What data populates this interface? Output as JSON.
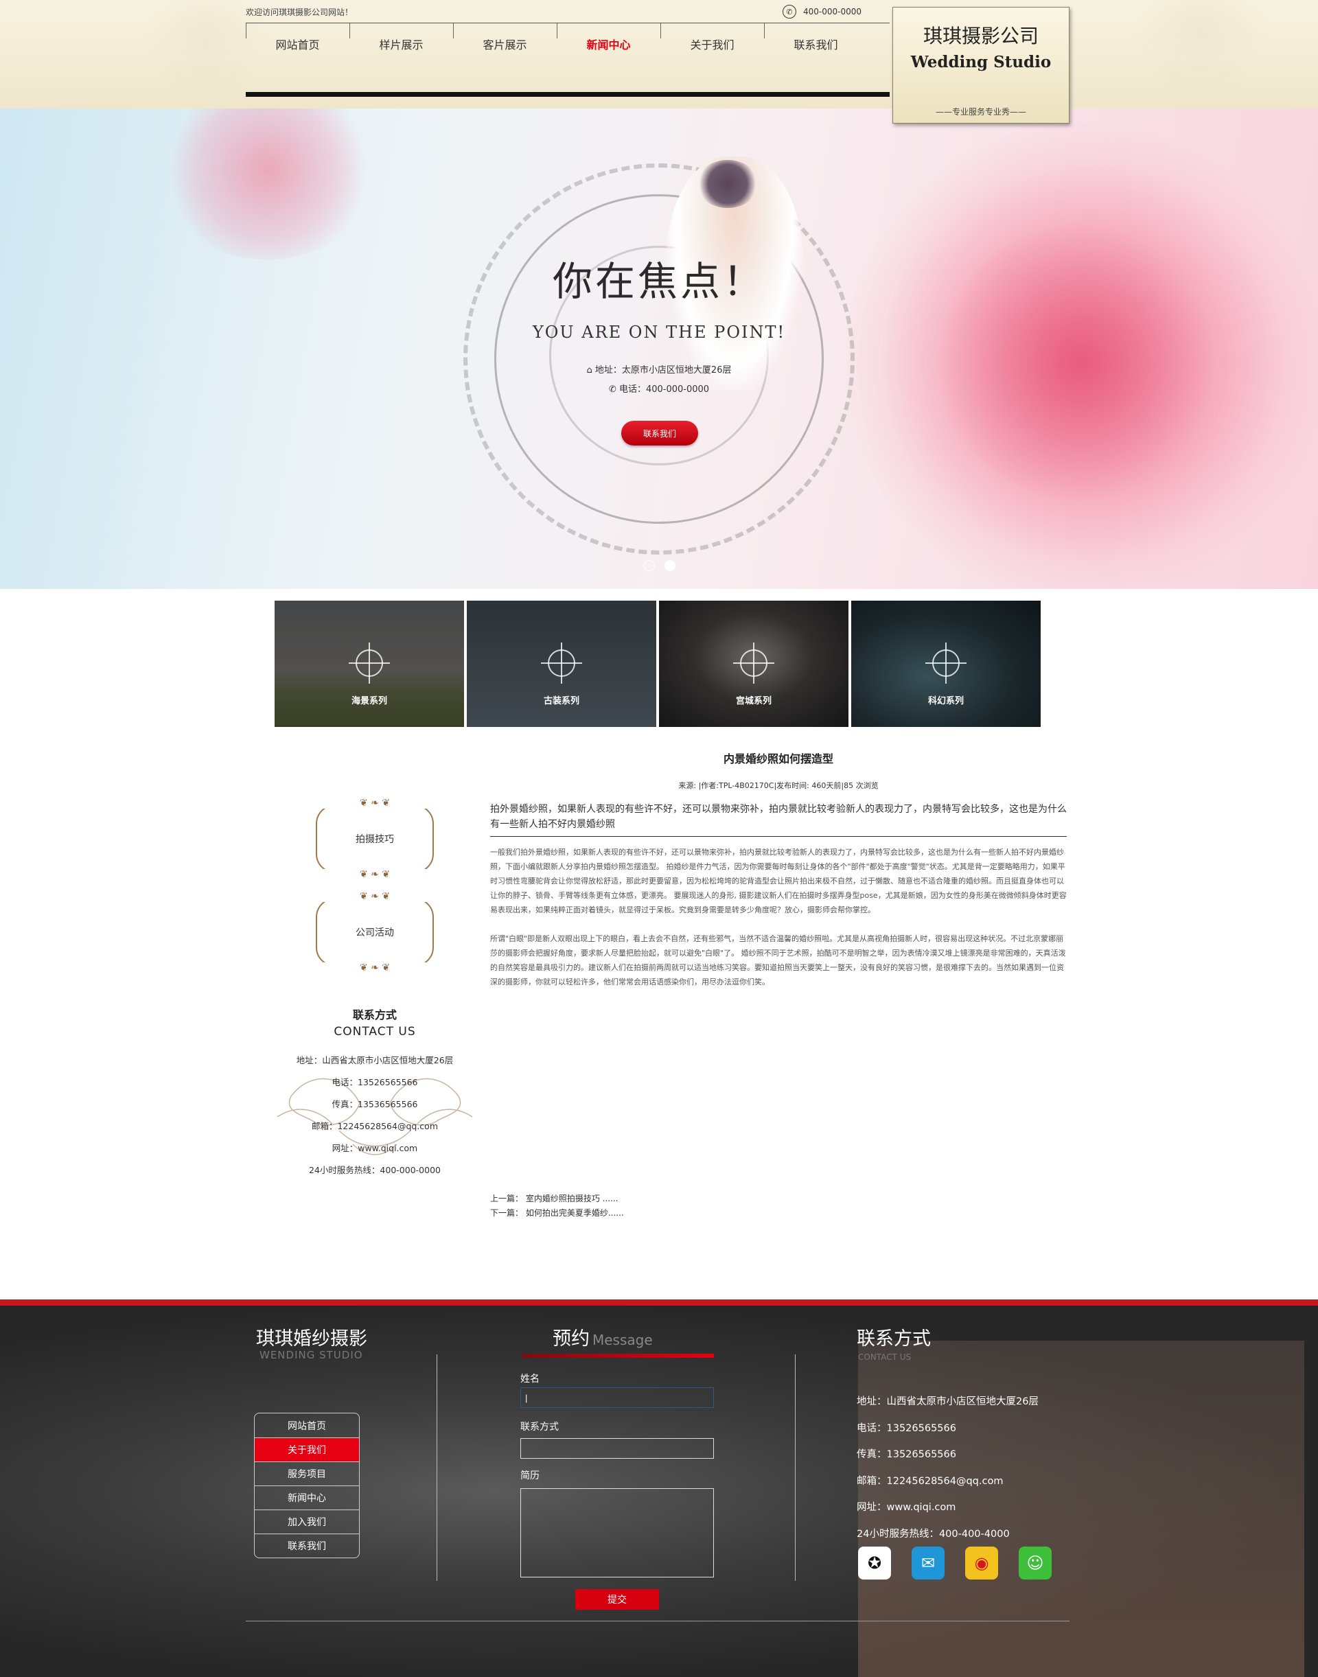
{
  "header": {
    "welcome": "欢迎访问琪琪摄影公司网站！",
    "phone": "400-000-0000",
    "nav": [
      "网站首页",
      "样片展示",
      "客片展示",
      "新闻中心",
      "关于我们",
      "联系我们"
    ],
    "nav_active_index": 3,
    "logo": {
      "cn": "琪琪摄影公司",
      "en": "Wedding Studio",
      "slogan": "——专业服务专业秀——"
    }
  },
  "banner": {
    "title_cn": "你在焦点！",
    "title_en": "YOU ARE ON THE POINT!",
    "address": "地址：太原市小店区恒地大厦26层",
    "tel": "电话：400-000-0000",
    "button": "联系我们",
    "slides": 2,
    "active_slide": 2
  },
  "gallery": [
    {
      "label": "海景系列"
    },
    {
      "label": "古装系列"
    },
    {
      "label": "宫城系列"
    },
    {
      "label": "科幻系列"
    }
  ],
  "sidebar": {
    "links": [
      "拍摄技巧",
      "公司活动"
    ],
    "contact": {
      "title": "联系方式",
      "subtitle": "CONTACT US",
      "items": [
        "地址：山西省太原市小店区恒地大厦26层",
        "电话：13526565566",
        "传真：13536565566",
        "邮箱：12245628564@qq.com",
        "网址：www.qiqi.com",
        "24小时服务热线：400-000-0000"
      ]
    }
  },
  "article": {
    "title": "内景婚纱照如何摆造型",
    "meta": "来源: |作者:TPL-4B02170C|发布时间: 460天前|85 次浏览",
    "lead": "拍外景婚纱照，如果新人表现的有些许不好，还可以景物来弥补，拍内景就比较考验新人的表现力了，内景特写会比较多，这也是为什么有一些新人拍不好内景婚纱照",
    "paragraphs": [
      "一般我们拍外景婚纱照，如果新人表现的有些许不好，还可以景物来弥补，拍内景就比较考验新人的表现力了，内景特写会比较多，这也是为什么有一些新人拍不好内景婚纱照，下面小编就跟新人分享拍内景婚纱照怎摆造型。 拍婚纱是件力气活，因为你需要每时每刻让身体的各个\"部件\"都处于高度\"警觉\"状态。尤其是背一定要略略用力，如果平时习惯性弯腰驼背会让你觉得放松舒适，那此时更要留意，因为松松垮垮的驼背造型会让照片拍出来极不自然，过于懒散、随意也不适合隆重的婚纱照。而且挺直身体也可以让你的脖子、锁骨、手臂等线条更有立体感，更漂亮。 要展现迷人的身形, 摄影建议新人们在拍摄时多摆弄身型pose，尤其是新娘，因为女性的身形美在微微倾斜身体时更容易表现出来，如果纯粹正面对着镜头，就显得过于呆板。究竟到身需要是转多少角度呢？放心，摄影师会帮你掌控。",
      "所谓\"白眼\"即是新人双眼出现上下的眼白，看上去会不自然，还有些邪气，当然不适合温馨的婚纱照啦。尤其是从高视角拍摄新人时，很容易出现这种状况。不过北京蒙娜丽莎的摄影师会把握好角度，要求新人尽量把脸抬起，就可以避免\"白眼\"了。 婚纱照不同于艺术照，拍酷可不是明智之举，因为表情冷漠又堆上镜漂亮是非常困难的，天真活泼的自然笑容是最具吸引力的。建议新人们在拍摄前两周就可以适当地练习笑容。要知道拍照当天要笑上一整天，没有良好的笑容习惯，是很难撑下去的。当然如果遇到一位资深的摄影师，你就可以轻松许多，他们常常会用话语感染你们，用尽办法逗你们笑。"
    ],
    "prev": "上一篇：   室内婚纱照拍摄技巧 ......",
    "next": "下一篇：   如何拍出完美夏季婚纱......"
  },
  "footer": {
    "brand": "琪琪婚纱摄影",
    "brand_en": "WENDING STUDIO",
    "menu": [
      "网站首页",
      "关于我们",
      "服务项目",
      "新闻中心",
      "加入我们",
      "联系我们"
    ],
    "menu_active_index": 1,
    "message": {
      "title": "预约",
      "title_en": "Message",
      "name_label": "姓名",
      "contact_label": "联系方式",
      "resume_label": "简历",
      "name_value": "|",
      "submit": "提交"
    },
    "contact": {
      "title": "联系方式",
      "subtitle": "CONTACT US",
      "items": [
        "地址：山西省太原市小店区恒地大厦26层",
        "电话：13526565566",
        "传真：13526565566",
        "邮箱：12245628564@qq.com",
        "网址：www.qiqi.com",
        "24小时服务热线：400-400-4000"
      ],
      "social": [
        "qq-icon",
        "mail-icon",
        "weibo-icon",
        "wechat-icon"
      ]
    }
  }
}
